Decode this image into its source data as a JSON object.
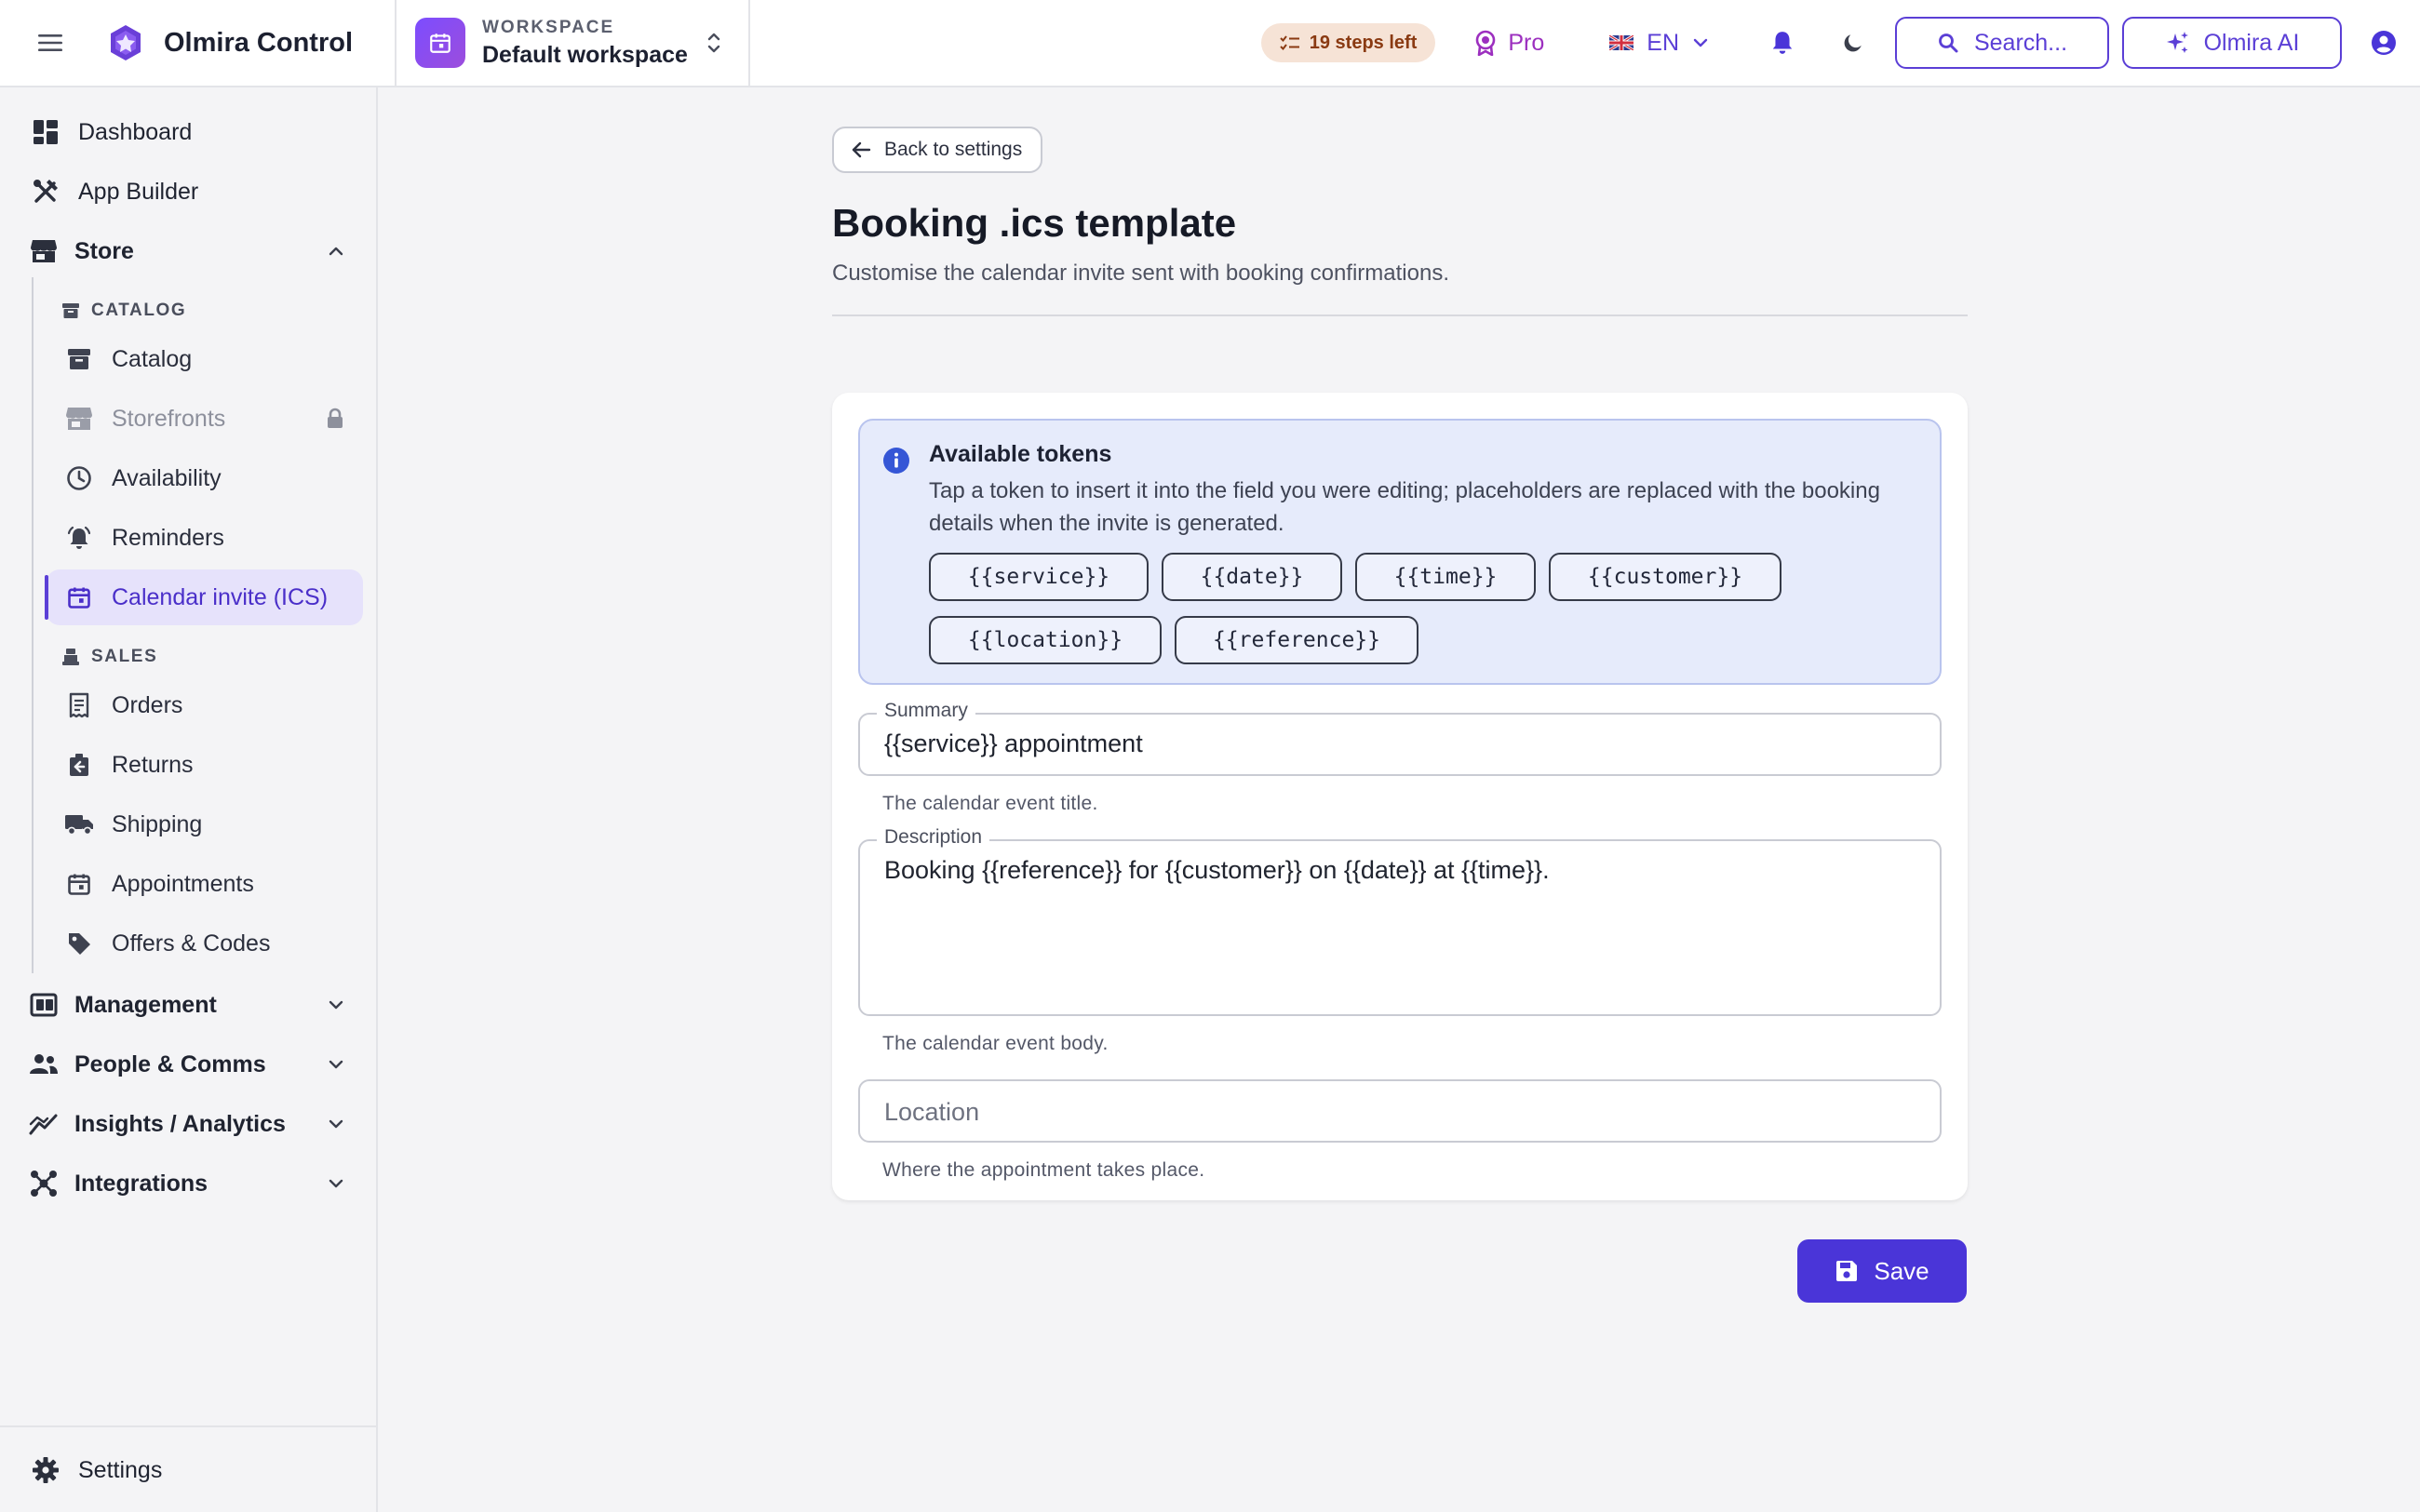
{
  "app": {
    "name": "Olmira Control",
    "accent": "#5b3fd6"
  },
  "workspace": {
    "label": "WORKSPACE",
    "name": "Default workspace"
  },
  "topbar": {
    "steps_left": "19 steps left",
    "plan": "Pro",
    "language": "EN",
    "search_label": "Search...",
    "ai_label": "Olmira AI"
  },
  "sidebar": {
    "dashboard": "Dashboard",
    "app_builder": "App Builder",
    "store": "Store",
    "catalog_section": "CATALOG",
    "catalog": "Catalog",
    "storefronts": "Storefronts",
    "availability": "Availability",
    "reminders": "Reminders",
    "calendar_invite": "Calendar invite (ICS)",
    "sales_section": "SALES",
    "orders": "Orders",
    "returns": "Returns",
    "shipping": "Shipping",
    "appointments": "Appointments",
    "offers": "Offers & Codes",
    "management": "Management",
    "people": "People & Comms",
    "insights": "Insights / Analytics",
    "integrations": "Integrations",
    "settings": "Settings"
  },
  "page": {
    "back_label": "Back to settings",
    "title": "Booking .ics template",
    "subtitle": "Customise the calendar invite sent with booking confirmations."
  },
  "tokens": {
    "title": "Available tokens",
    "description": "Tap a token to insert it into the field you were editing; placeholders are replaced with the booking details when the invite is generated.",
    "items": [
      "{{service}}",
      "{{date}}",
      "{{time}}",
      "{{customer}}",
      "{{location}}",
      "{{reference}}"
    ]
  },
  "form": {
    "summary": {
      "label": "Summary",
      "value": "{{service}} appointment",
      "helper": "The calendar event title."
    },
    "description": {
      "label": "Description",
      "value": "Booking {{reference}} for {{customer}} on {{date}} at {{time}}.",
      "helper": "The calendar event body."
    },
    "location": {
      "placeholder": "Location",
      "value": "",
      "helper": "Where the appointment takes place."
    },
    "save_label": "Save"
  }
}
